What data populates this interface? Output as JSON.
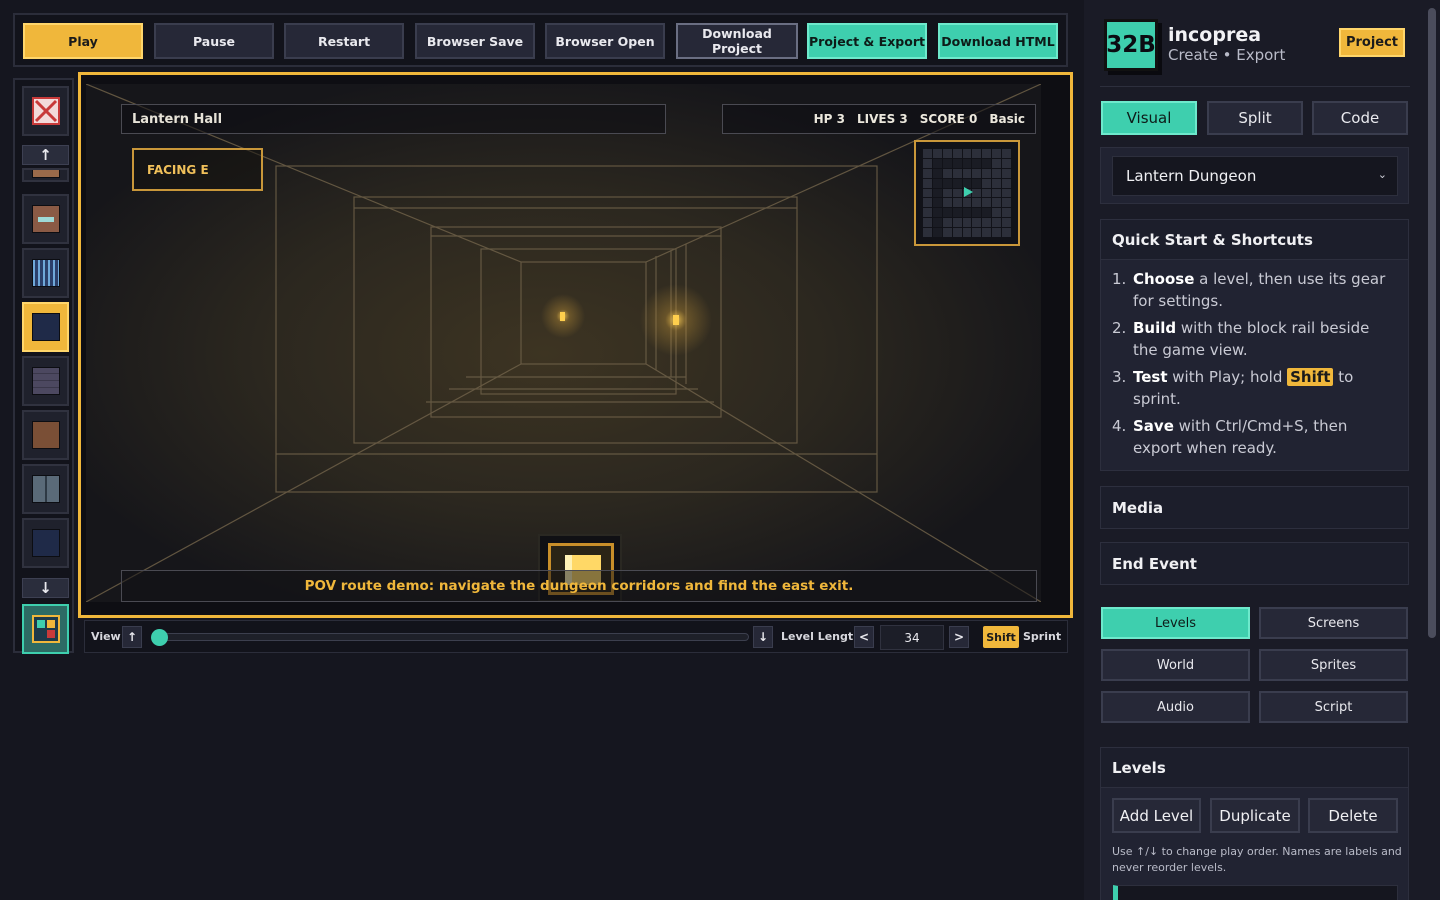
{
  "toolbar": {
    "play": "Play",
    "pause": "Pause",
    "restart": "Restart",
    "browser_save": "Browser Save",
    "browser_open": "Browser Open",
    "download_project": "Download Project",
    "project_export": "Project & Export",
    "download_html": "Download HTML"
  },
  "rail": {
    "up_arrow": "↑",
    "down_arrow": "↓",
    "tiles": [
      {
        "name": "erase-tile",
        "color": "#c83a3a"
      },
      {
        "name": "brick-tile",
        "color": "#9a6a4a"
      },
      {
        "name": "door-tile",
        "color": "#8a5a45"
      },
      {
        "name": "gate-tile",
        "color": "#3a5f8a"
      },
      {
        "name": "floor-tile",
        "color": "#2b3654"
      },
      {
        "name": "stone-wall-tile",
        "color": "#4c4860"
      },
      {
        "name": "dirt-tile",
        "color": "#7a4f36"
      },
      {
        "name": "slate-tile",
        "color": "#5a6a78"
      },
      {
        "name": "dark-floor-tile",
        "color": "#1f2a48"
      },
      {
        "name": "map-tile",
        "color": "#3ecfae"
      }
    ]
  },
  "game": {
    "location": "Lantern Hall",
    "hp": "HP 3",
    "lives": "LIVES 3",
    "score": "SCORE 0",
    "difficulty": "Basic",
    "facing": "FACING E",
    "caption": "POV route demo: navigate the dungeon corridors and find the east exit."
  },
  "viewbar": {
    "view_label": "View",
    "up": "↑",
    "down": "↓",
    "slider_value": 0,
    "level_length_label": "Level Length",
    "decrement": "<",
    "increment": ">",
    "level_length_value": "34",
    "shift_key": "Shift",
    "sprint_label": "Sprint"
  },
  "sidebar": {
    "logo": "32B",
    "brand_name": "incoprea",
    "brand_sub": "Create • Export",
    "project_button": "Project",
    "modes": [
      "Visual",
      "Split",
      "Code"
    ],
    "active_mode": "Visual",
    "game_select": "Lantern Dungeon",
    "quick_start": {
      "title": "Quick Start & Shortcuts",
      "steps": [
        {
          "num": "1.",
          "bold": "Choose",
          "rest": " a level, then use its gear for settings."
        },
        {
          "num": "2.",
          "bold": "Build",
          "rest": " with the block rail beside the game view."
        },
        {
          "num": "3.",
          "bold": "Test",
          "rest": " with Play; hold ",
          "kbd": "Shift",
          "after": " to sprint."
        },
        {
          "num": "4.",
          "bold": "Save",
          "rest": " with Ctrl/Cmd+S, then export when ready."
        }
      ]
    },
    "media_title": "Media",
    "end_event_title": "End Event",
    "tabs": [
      "Levels",
      "Screens",
      "World",
      "Sprites",
      "Audio",
      "Script"
    ],
    "active_tab": "Levels",
    "levels": {
      "title": "Levels",
      "add": "Add Level",
      "duplicate": "Duplicate",
      "delete": "Delete",
      "note": "Use ↑/↓ to change play order. Names are labels and never reorder levels."
    }
  },
  "colors": {
    "accent_teal": "#3ecfae",
    "accent_gold": "#f0b73b",
    "background": "#15161f",
    "panel": "#212332"
  }
}
